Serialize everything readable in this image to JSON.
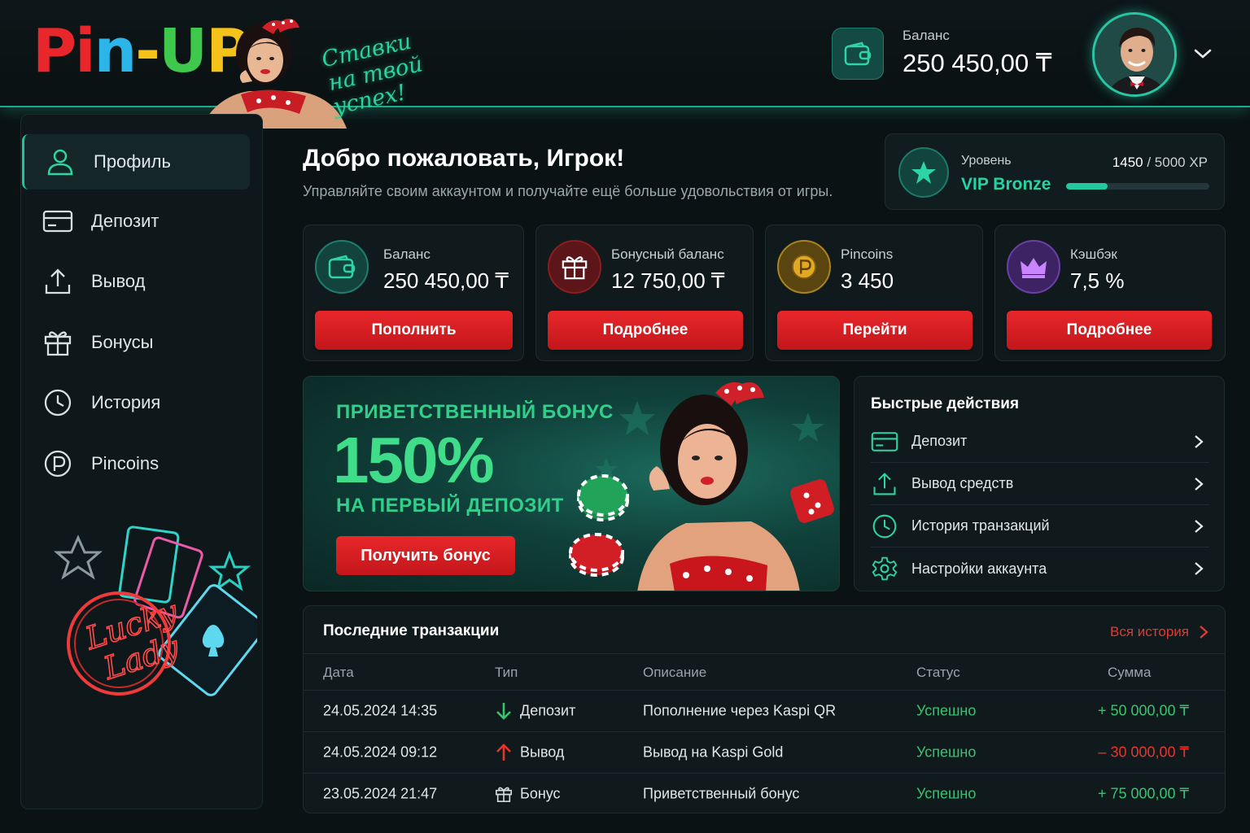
{
  "header": {
    "logo": [
      "Pi",
      "n",
      "-",
      "U",
      "P",
      ""
    ],
    "slogan_line1": "Ставки",
    "slogan_line2": "на твой успех!",
    "balance_label": "Баланс",
    "balance_value": "250 450,00 ₸"
  },
  "sidebar": {
    "items": [
      {
        "label": "Профиль",
        "icon": "user-icon",
        "active": true
      },
      {
        "label": "Депозит",
        "icon": "card-icon"
      },
      {
        "label": "Вывод",
        "icon": "upload-icon"
      },
      {
        "label": "Бонусы",
        "icon": "gift-icon"
      },
      {
        "label": "История",
        "icon": "clock-icon"
      },
      {
        "label": "Pincoins",
        "icon": "pincoin-icon"
      }
    ],
    "neon_sign": {
      "line1": "Lucky",
      "line2": "Lady"
    }
  },
  "welcome": {
    "title": "Добро пожаловать, Игрок!",
    "subtitle": "Управляйте своим аккаунтом и получайте ещё больше удовольствия от игры."
  },
  "level": {
    "label": "Уровень",
    "name": "VIP Bronze",
    "xp_current": "1450",
    "xp_rest": " / 5000 XP",
    "progress": 0.29
  },
  "stats": [
    {
      "label": "Баланс",
      "value": "250 450,00 ₸",
      "button": "Пополнить",
      "icon": "wallet-icon",
      "color": "#1f7d6c"
    },
    {
      "label": "Бонусный баланс",
      "value": "12 750,00 ₸",
      "button": "Подробнее",
      "icon": "gift-icon",
      "color": "#8a1d20"
    },
    {
      "label": "Pincoins",
      "value": "3 450",
      "button": "Перейти",
      "icon": "pincoin-icon",
      "color": "#8a6a12"
    },
    {
      "label": "Кэшбэк",
      "value": "7,5 %",
      "button": "Подробнее",
      "icon": "crown-icon",
      "color": "#5a2f8e"
    }
  ],
  "promo": {
    "line1": "ПРИВЕТСТВЕННЫЙ БОНУС",
    "line2": "150%",
    "line3": "НА ПЕРВЫЙ ДЕПОЗИТ",
    "button": "Получить бонус"
  },
  "quick_actions": {
    "title": "Быстрые действия",
    "items": [
      {
        "label": "Депозит",
        "icon": "card-icon"
      },
      {
        "label": "Вывод средств",
        "icon": "upload-icon"
      },
      {
        "label": "История транзакций",
        "icon": "clock-icon"
      },
      {
        "label": "Настройки аккаунта",
        "icon": "gear-icon"
      }
    ]
  },
  "transactions": {
    "title": "Последние транзакции",
    "all_link": "Вся история",
    "columns": [
      "Дата",
      "Тип",
      "Описание",
      "Статус",
      "Сумма"
    ],
    "rows": [
      {
        "date": "24.05.2024 14:35",
        "type": "Депозит",
        "type_icon": "arrow-down-icon",
        "desc": "Пополнение через Kaspi QR",
        "status": "Успешно",
        "sum": "+ 50 000,00 ₸",
        "positive": true
      },
      {
        "date": "24.05.2024 09:12",
        "type": "Вывод",
        "type_icon": "arrow-up-icon",
        "desc": "Вывод на Kaspi Gold",
        "status": "Успешно",
        "sum": "– 30 000,00 ₸",
        "positive": false
      },
      {
        "date": "23.05.2024 21:47",
        "type": "Бонус",
        "type_icon": "gift-icon",
        "desc": "Приветственный бонус",
        "status": "Успешно",
        "sum": "+ 75 000,00 ₸",
        "positive": true
      }
    ]
  }
}
